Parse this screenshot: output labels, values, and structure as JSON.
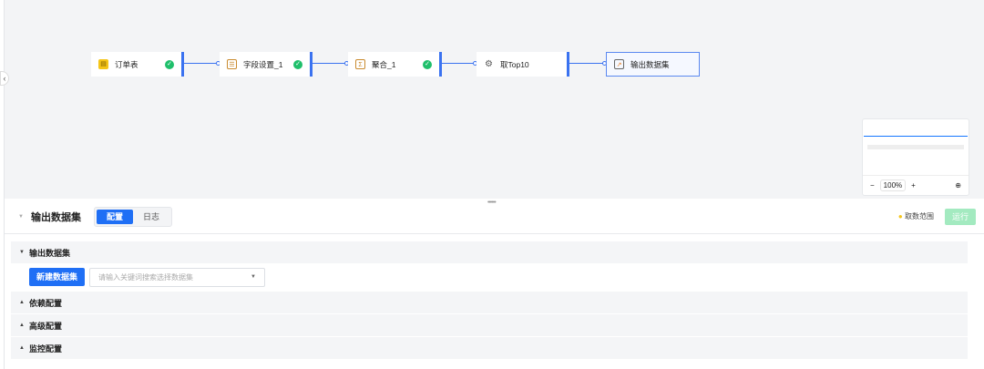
{
  "flow": {
    "nodes": [
      {
        "label": "订单表",
        "icon": "table-icon",
        "ok": true
      },
      {
        "label": "字段设置_1",
        "icon": "field-settings-icon",
        "ok": true
      },
      {
        "label": "聚合_1",
        "icon": "sigma-icon",
        "ok": true
      },
      {
        "label": "取Top10",
        "icon": "gear-icon",
        "ok": false
      },
      {
        "label": "输出数据集",
        "icon": "output-icon",
        "ok": false
      }
    ]
  },
  "minimap": {
    "zoom": "100%",
    "minus": "−",
    "plus": "+"
  },
  "panel": {
    "title": "输出数据集",
    "tabs": [
      "配置",
      "日志"
    ],
    "range_label": "取数范围",
    "run_label": "运行",
    "sections": [
      "输出数据集",
      "依赖配置",
      "高级配置",
      "监控配置"
    ],
    "new_dataset_label": "新建数据集",
    "dataset_placeholder": "请输入关键词搜索选择数据集"
  }
}
